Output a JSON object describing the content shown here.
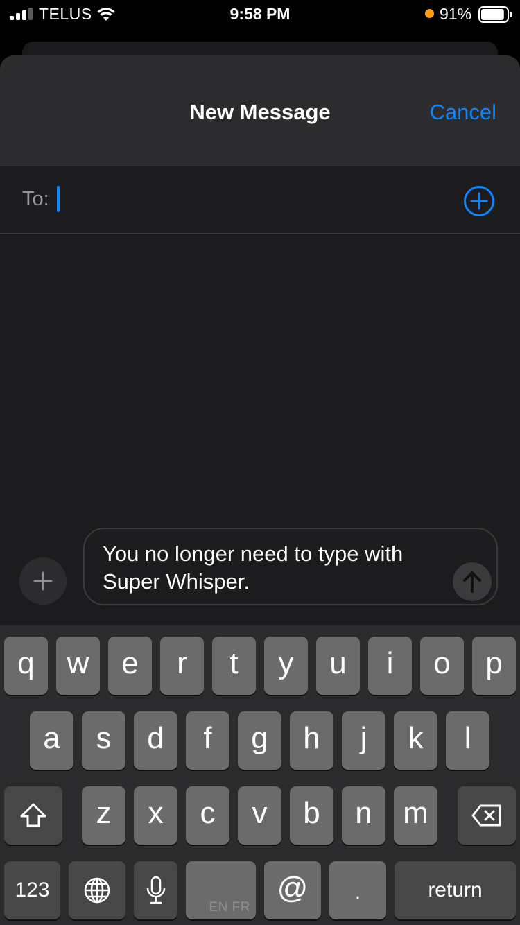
{
  "status_bar": {
    "carrier": "TELUS",
    "time": "9:58 PM",
    "battery_percent": "91%",
    "battery_level": 0.91,
    "signal_bars": 3,
    "icons": [
      "signal-bars-icon",
      "wifi-icon",
      "privacy-indicator-dot",
      "battery-icon"
    ],
    "privacy_dot_color": "#ff9f0a"
  },
  "nav": {
    "title": "New Message",
    "cancel_label": "Cancel"
  },
  "recipients": {
    "to_label": "To:",
    "value": "",
    "add_icon": "plus-circle-icon"
  },
  "compose": {
    "message_text": "You no longer need to type with Super Whisper.",
    "attach_icon": "plus-icon",
    "send_icon": "arrow-up-icon"
  },
  "keyboard": {
    "row1": [
      "q",
      "w",
      "e",
      "r",
      "t",
      "y",
      "u",
      "i",
      "o",
      "p"
    ],
    "row2": [
      "a",
      "s",
      "d",
      "f",
      "g",
      "h",
      "j",
      "k",
      "l"
    ],
    "row3": [
      "z",
      "x",
      "c",
      "v",
      "b",
      "n",
      "m"
    ],
    "numbers_label": "123",
    "space_hint": "EN FR",
    "at_label": "@",
    "period_label": ".",
    "return_label": "return",
    "icons": [
      "shift-icon",
      "delete-icon",
      "globe-icon",
      "microphone-icon"
    ]
  },
  "colors": {
    "accent": "#0a84ff",
    "background": "#1c1c1e",
    "nav_background": "#2c2c2e",
    "key_light": "#6b6b6b",
    "key_dark": "#474747"
  }
}
